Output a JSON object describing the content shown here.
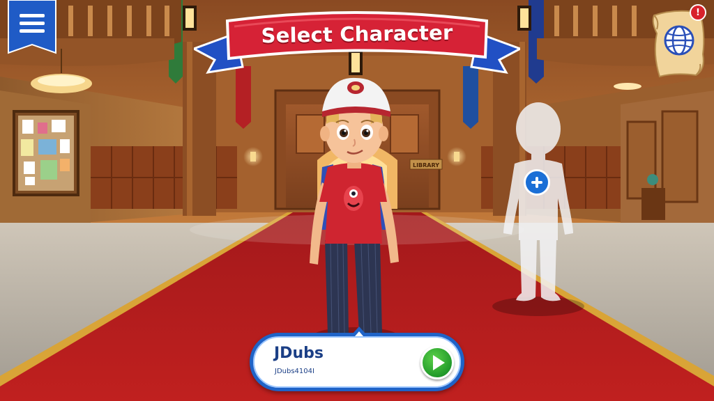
{
  "header": {
    "title": "Select Character"
  },
  "hallway": {
    "door_sign": "LIBRARY"
  },
  "character_card": {
    "display_name": "JDubs",
    "username": "JDubs4104I"
  },
  "notifications": {
    "badge": "!"
  },
  "icons": {
    "menu": "hamburger-menu-icon",
    "globe": "globe-icon",
    "add": "plus-icon",
    "play": "play-icon"
  },
  "colors": {
    "banner_red": "#d62236",
    "banner_blue": "#2150c4",
    "carpet_red": "#b81d1d",
    "card_border": "#1f63c7",
    "play_green": "#2aa534"
  }
}
